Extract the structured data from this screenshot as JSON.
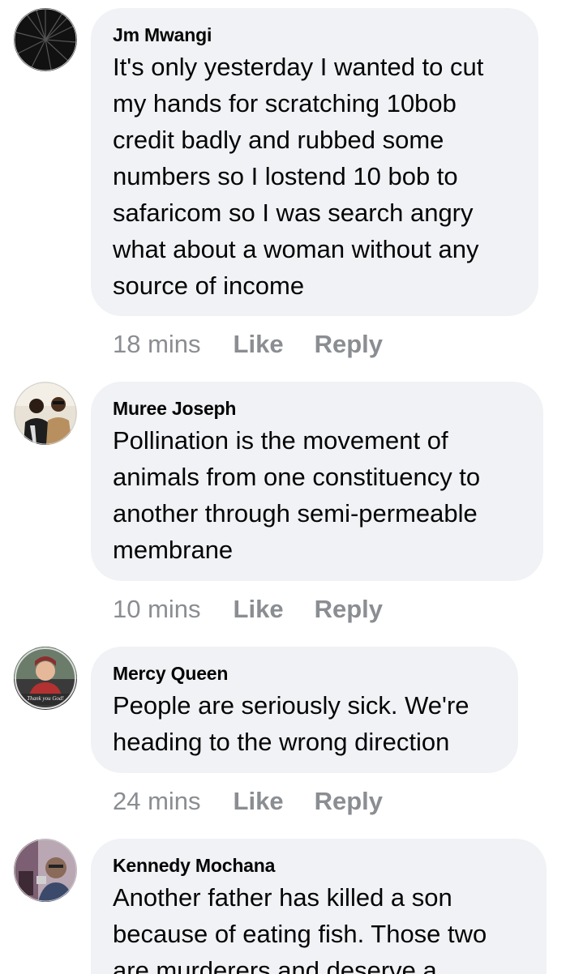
{
  "comments": [
    {
      "author": "Jm Mwangi",
      "lines": [
        "It's only yesterday I wanted to cut",
        "my hands for scratching 10bob",
        "credit badly and rubbed some",
        "numbers so I lostend 10 bob to",
        "safaricom so I was search angry",
        "what about a woman without any",
        "source of income"
      ],
      "time": "18 mins",
      "like_label": "Like",
      "reply_label": "Reply"
    },
    {
      "author": "Muree Joseph",
      "lines": [
        "Pollination is the movement of",
        "animals from one constituency to",
        "another through semi-permeable",
        "membrane"
      ],
      "time": "10 mins",
      "like_label": "Like",
      "reply_label": "Reply"
    },
    {
      "author": "Mercy Queen",
      "lines": [
        "People are seriously sick. We're",
        "heading to the wrong direction"
      ],
      "time": "24 mins",
      "like_label": "Like",
      "reply_label": "Reply",
      "avatar_caption": "Thank you God!"
    },
    {
      "author": "Kennedy Mochana",
      "lines": [
        "Another father has killed a son",
        "because of eating fish. Those two",
        "are murderers and deserve a"
      ]
    }
  ],
  "colors": {
    "bubble_bg": "#f0f2f5",
    "text": "#050505",
    "meta": "#8a8d91"
  }
}
